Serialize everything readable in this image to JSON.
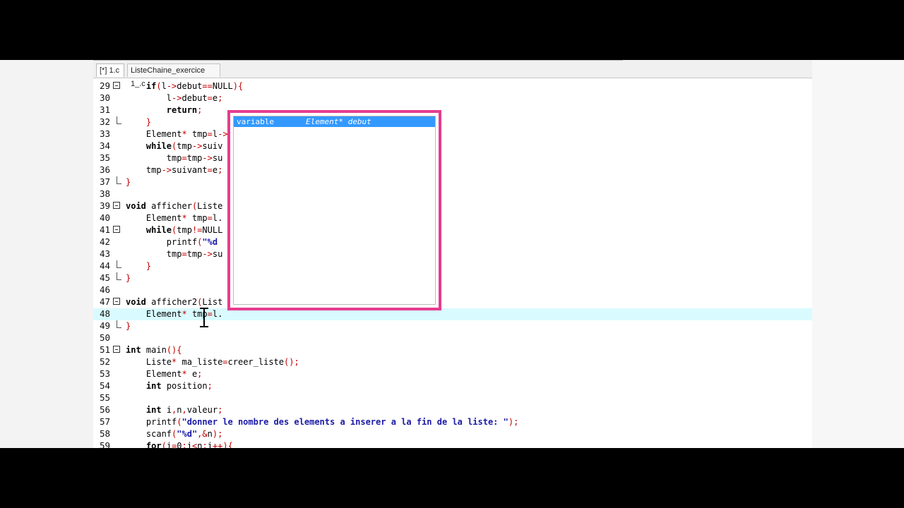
{
  "tabs": [
    {
      "label": "[*] 1.c",
      "active": true
    },
    {
      "label": "ListeChaine_exercice 1_.c",
      "active": false
    }
  ],
  "lines": [
    {
      "num": "29",
      "text": "    if(l->debut==NULL){"
    },
    {
      "num": "30",
      "text": "        l->debut=e;"
    },
    {
      "num": "31",
      "text": "        return;"
    },
    {
      "num": "32",
      "text": "    }"
    },
    {
      "num": "33",
      "text": "    Element* tmp=l->"
    },
    {
      "num": "34",
      "text": "    while(tmp->suiv"
    },
    {
      "num": "35",
      "text": "        tmp=tmp->su"
    },
    {
      "num": "36",
      "text": "    tmp->suivant=e;"
    },
    {
      "num": "37",
      "text": "}"
    },
    {
      "num": "38",
      "text": ""
    },
    {
      "num": "39",
      "text": "void afficher(Liste"
    },
    {
      "num": "40",
      "text": "    Element* tmp=l."
    },
    {
      "num": "41",
      "text": "    while(tmp!=NULL"
    },
    {
      "num": "42",
      "text": "        printf(\"%d"
    },
    {
      "num": "43",
      "text": "        tmp=tmp->su"
    },
    {
      "num": "44",
      "text": "    }"
    },
    {
      "num": "45",
      "text": "}"
    },
    {
      "num": "46",
      "text": ""
    },
    {
      "num": "47",
      "text": "void afficher2(List"
    },
    {
      "num": "48",
      "text": "    Element* tmp=l."
    },
    {
      "num": "49",
      "text": "}"
    },
    {
      "num": "50",
      "text": ""
    },
    {
      "num": "51",
      "text": "int main(){"
    },
    {
      "num": "52",
      "text": "    Liste* ma_liste=creer_liste();"
    },
    {
      "num": "53",
      "text": "    Element* e;"
    },
    {
      "num": "54",
      "text": "    int position;"
    },
    {
      "num": "55",
      "text": ""
    },
    {
      "num": "56",
      "text": "    int i,n,valeur;"
    },
    {
      "num": "57",
      "text": "    printf(\"donner le nombre des elements a inserer a la fin de la liste: \");"
    },
    {
      "num": "58",
      "text": "    scanf(\"%d\",&n);"
    },
    {
      "num": "59",
      "text": "    for(i=0;i<n;i++){"
    }
  ],
  "autocomplete": {
    "kind": "variable",
    "type_name": "Element* debut"
  },
  "colors": {
    "popup_border": "#e63c8e",
    "selection": "#3399ff",
    "current_line": "#d9fbff",
    "operator": "#c00000",
    "string": "#1a1aa6"
  }
}
